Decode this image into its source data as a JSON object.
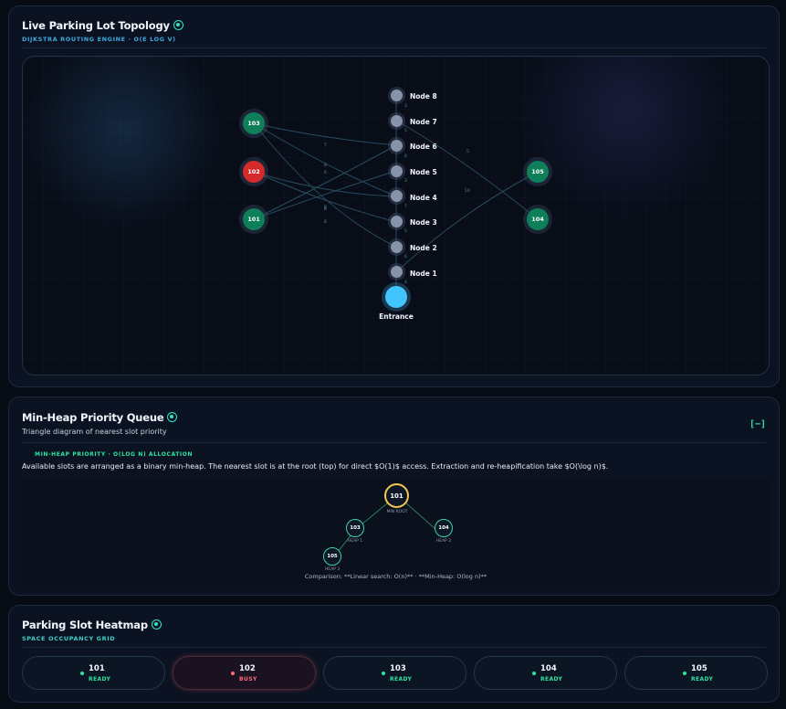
{
  "topology": {
    "title": "Live Parking Lot Topology",
    "subtitle": "DIJKSTRA ROUTING ENGINE · O(E LOG V)",
    "waypoints": [
      "Node 8",
      "Node 7",
      "Node 6",
      "Node 5",
      "Node 4",
      "Node 3",
      "Node 2",
      "Node 1"
    ],
    "slots": [
      {
        "id": "103",
        "status": "ready"
      },
      {
        "id": "102",
        "status": "busy"
      },
      {
        "id": "101",
        "status": "ready"
      },
      {
        "id": "105",
        "status": "ready"
      },
      {
        "id": "104",
        "status": "ready"
      }
    ],
    "entrance_label": "Entrance",
    "edge_weights": [
      "3",
      "5",
      "4",
      "3",
      "7",
      "5",
      "6",
      "4",
      "7",
      "8",
      "6",
      "8",
      "8",
      "8",
      "5",
      "10"
    ],
    "colors": {
      "ready": "#0f7f5a",
      "busy": "#d42a2a",
      "waypoint": "#8792ab",
      "entrance": "#41c4ff",
      "edge": "#2a5366"
    }
  },
  "heap": {
    "title": "Min-Heap Priority Queue",
    "description": "Triangle diagram of nearest slot priority",
    "toggle_label": "[−]",
    "kicker": "MIN-HEAP PRIORITY · O(LOG N) ALLOCATION",
    "text": "Available slots are arranged as a binary min-heap. The nearest slot is at the root (top) for direct $O(1)$ access. Extraction and re-heapification take $O(\\log n)$.",
    "nodes": [
      {
        "id": "101",
        "caption": "MIN ROOT"
      },
      {
        "id": "103",
        "caption": "HEAP 1"
      },
      {
        "id": "104",
        "caption": "HEAP 2"
      },
      {
        "id": "105",
        "caption": "HEAP 3"
      }
    ],
    "comparison": "Comparison: **Linear search: O(n)** · **Min-Heap: O(log n)**"
  },
  "heatmap": {
    "title": "Parking Slot Heatmap",
    "subtitle": "SPACE OCCUPANCY GRID",
    "slots": [
      {
        "id": "101",
        "status": "READY"
      },
      {
        "id": "102",
        "status": "BUSY"
      },
      {
        "id": "103",
        "status": "READY"
      },
      {
        "id": "104",
        "status": "READY"
      },
      {
        "id": "105",
        "status": "READY"
      }
    ]
  }
}
